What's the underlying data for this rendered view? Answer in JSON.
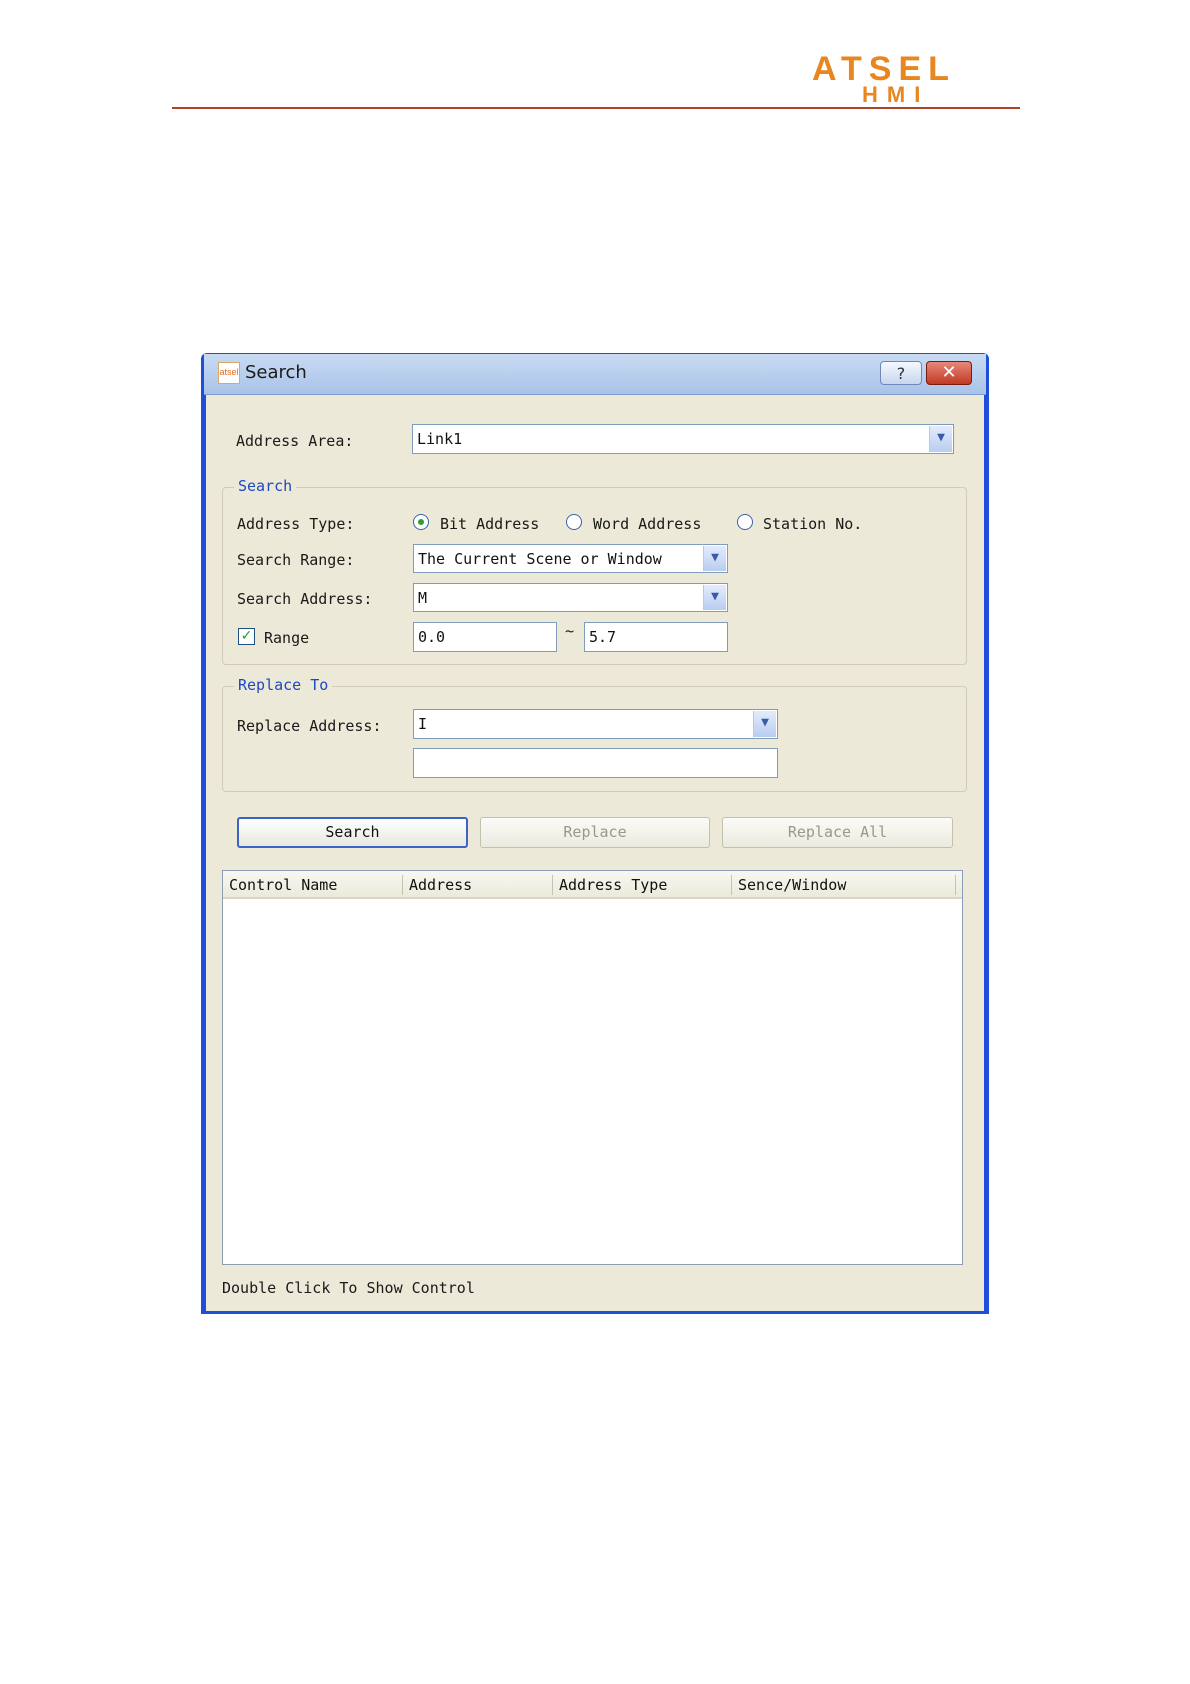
{
  "brand": {
    "logo_top": "ATSEL",
    "logo_bottom": "HMI"
  },
  "dialog": {
    "title": "Search",
    "help_label": "?",
    "close_label": "✕"
  },
  "address_area": {
    "label": "Address Area:",
    "value": "Link1"
  },
  "search_group": {
    "title": "Search",
    "address_type_label": "Address Type:",
    "address_types": [
      {
        "label": "Bit Address",
        "selected": true
      },
      {
        "label": "Word Address",
        "selected": false
      },
      {
        "label": "Station No.",
        "selected": false
      }
    ],
    "search_range_label": "Search Range:",
    "search_range_value": "The Current Scene or Window",
    "search_address_label": "Search Address:",
    "search_address_value": "M",
    "range_label": "Range",
    "range_checked": true,
    "range_from": "0.0",
    "range_separator": "~",
    "range_to": "5.7"
  },
  "replace_group": {
    "title": "Replace To",
    "replace_address_label": "Replace Address:",
    "replace_address_value": "I",
    "replace_value": ""
  },
  "buttons": {
    "search": "Search",
    "replace": "Replace",
    "replace_all": "Replace All"
  },
  "results": {
    "columns": [
      "Control Name",
      "Address",
      "Address Type",
      "Sence/Window"
    ],
    "rows": []
  },
  "footer_hint": "Double Click To Show Control",
  "colors": {
    "accent": "#1f47c2",
    "brand": "#e8861f",
    "window_frame": "#1f4fd8",
    "client_bg": "#ece9d8"
  },
  "icons": {
    "dropdown": "chevron-down-icon",
    "check": "checkmark-icon",
    "app": "app-logo-icon"
  }
}
